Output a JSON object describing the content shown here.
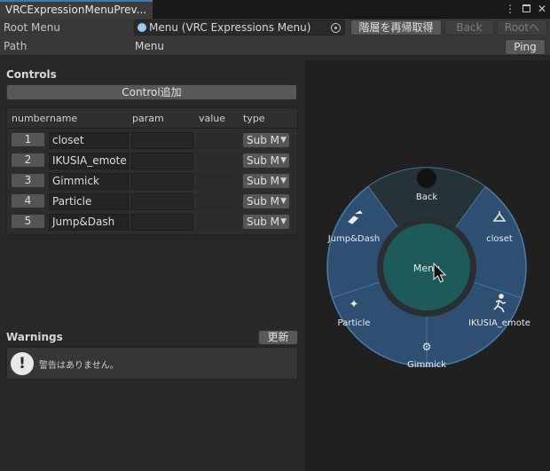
{
  "window": {
    "tab_title": "VRCExpressionMenuPrev...",
    "menu_icon": "kebab-menu-icon",
    "max_icon": "maximize-icon",
    "close_icon": "close-icon"
  },
  "header": {
    "root_menu_label": "Root Menu",
    "root_menu_value": "Menu (VRC Expressions Menu)",
    "refetch_button": "階層を再帰取得",
    "back_button": "Back",
    "root_button": "Rootへ",
    "path_label": "Path",
    "path_value": "Menu",
    "ping_button": "Ping"
  },
  "controls": {
    "section_title": "Controls",
    "add_button": "Control追加",
    "columns": [
      "number",
      "name",
      "param",
      "value",
      "type"
    ],
    "rows": [
      {
        "number": "1",
        "name": "closet",
        "param": "",
        "value": "",
        "type": "Sub M"
      },
      {
        "number": "2",
        "name": "IKUSIA_emote",
        "param": "",
        "value": "",
        "type": "Sub M"
      },
      {
        "number": "3",
        "name": "Gimmick",
        "param": "",
        "value": "",
        "type": "Sub M"
      },
      {
        "number": "4",
        "name": "Particle",
        "param": "",
        "value": "",
        "type": "Sub M"
      },
      {
        "number": "5",
        "name": "Jump&Dash",
        "param": "",
        "value": "",
        "type": "Sub M"
      }
    ]
  },
  "warnings": {
    "section_title": "Warnings",
    "refresh_button": "更新",
    "message": "警告はありません。",
    "icon": "warning-exclamation-icon"
  },
  "radial_menu": {
    "center_label": "Menu",
    "back_label": "Back",
    "items": [
      {
        "label": "closet",
        "icon": "hanger-icon"
      },
      {
        "label": "IKUSIA_emote",
        "icon": "running-person-icon"
      },
      {
        "label": "Gimmick",
        "icon": "gear-icon"
      },
      {
        "label": "Particle",
        "icon": "sparkle-icon"
      },
      {
        "label": "Jump&Dash",
        "icon": "jump-shoes-icon"
      }
    ],
    "colors": {
      "ring": "#2f4f72",
      "back_segment": "#253238",
      "center": "#1d5a59",
      "border": "#4d7ba8"
    }
  }
}
